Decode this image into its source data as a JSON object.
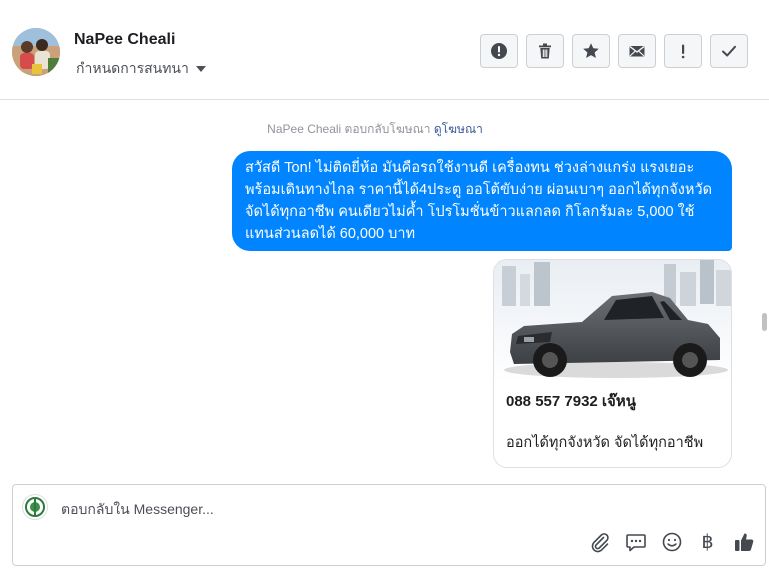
{
  "header": {
    "contact_name": "NaPee Cheali",
    "settings_label": "กำหนดการสนทนา",
    "actions": [
      {
        "name": "alert-icon",
        "label": "!"
      },
      {
        "name": "trash-icon",
        "label": "delete"
      },
      {
        "name": "star-icon",
        "label": "star"
      },
      {
        "name": "envelope-icon",
        "label": "mark unread"
      },
      {
        "name": "exclamation-icon",
        "label": "!"
      },
      {
        "name": "check-icon",
        "label": "done"
      }
    ]
  },
  "thread": {
    "reply_note_prefix": "NaPee Cheali ตอบกลับโฆษณา",
    "reply_note_link": "ดูโฆษณา",
    "message_text": "สวัสดี Ton! ไม่ติดยี่ห้อ มันคือรถใช้งานดี เครื่องทน ช่วงล่างแกร่ง แรงเยอะ พร้อมเดินทางไกล ราคานี้ได้4ประตู ออโต้ขับง่าย ผ่อนเบาๆ ออกได้ทุกจังหวัด จัดได้ทุกอาชีพ คนเดียวไม่ค้ำ โปรโมชั่นข้าวแลกลด กิโลกรัมละ 5,000 ใช้แทนส่วนลดได้ 60,000 บาท",
    "card": {
      "title": "088 557 7932 เจ๊หนู",
      "subtitle": "ออกได้ทุกจังหวัด จัดได้ทุกอาชีพ",
      "image_alt": "grey pickup truck"
    }
  },
  "composer": {
    "placeholder": "ตอบกลับใน Messenger...",
    "value": "",
    "currency_symbol": "฿"
  },
  "colors": {
    "bubble": "#0084ff",
    "link": "#385898",
    "border": "#ccd0d5"
  }
}
